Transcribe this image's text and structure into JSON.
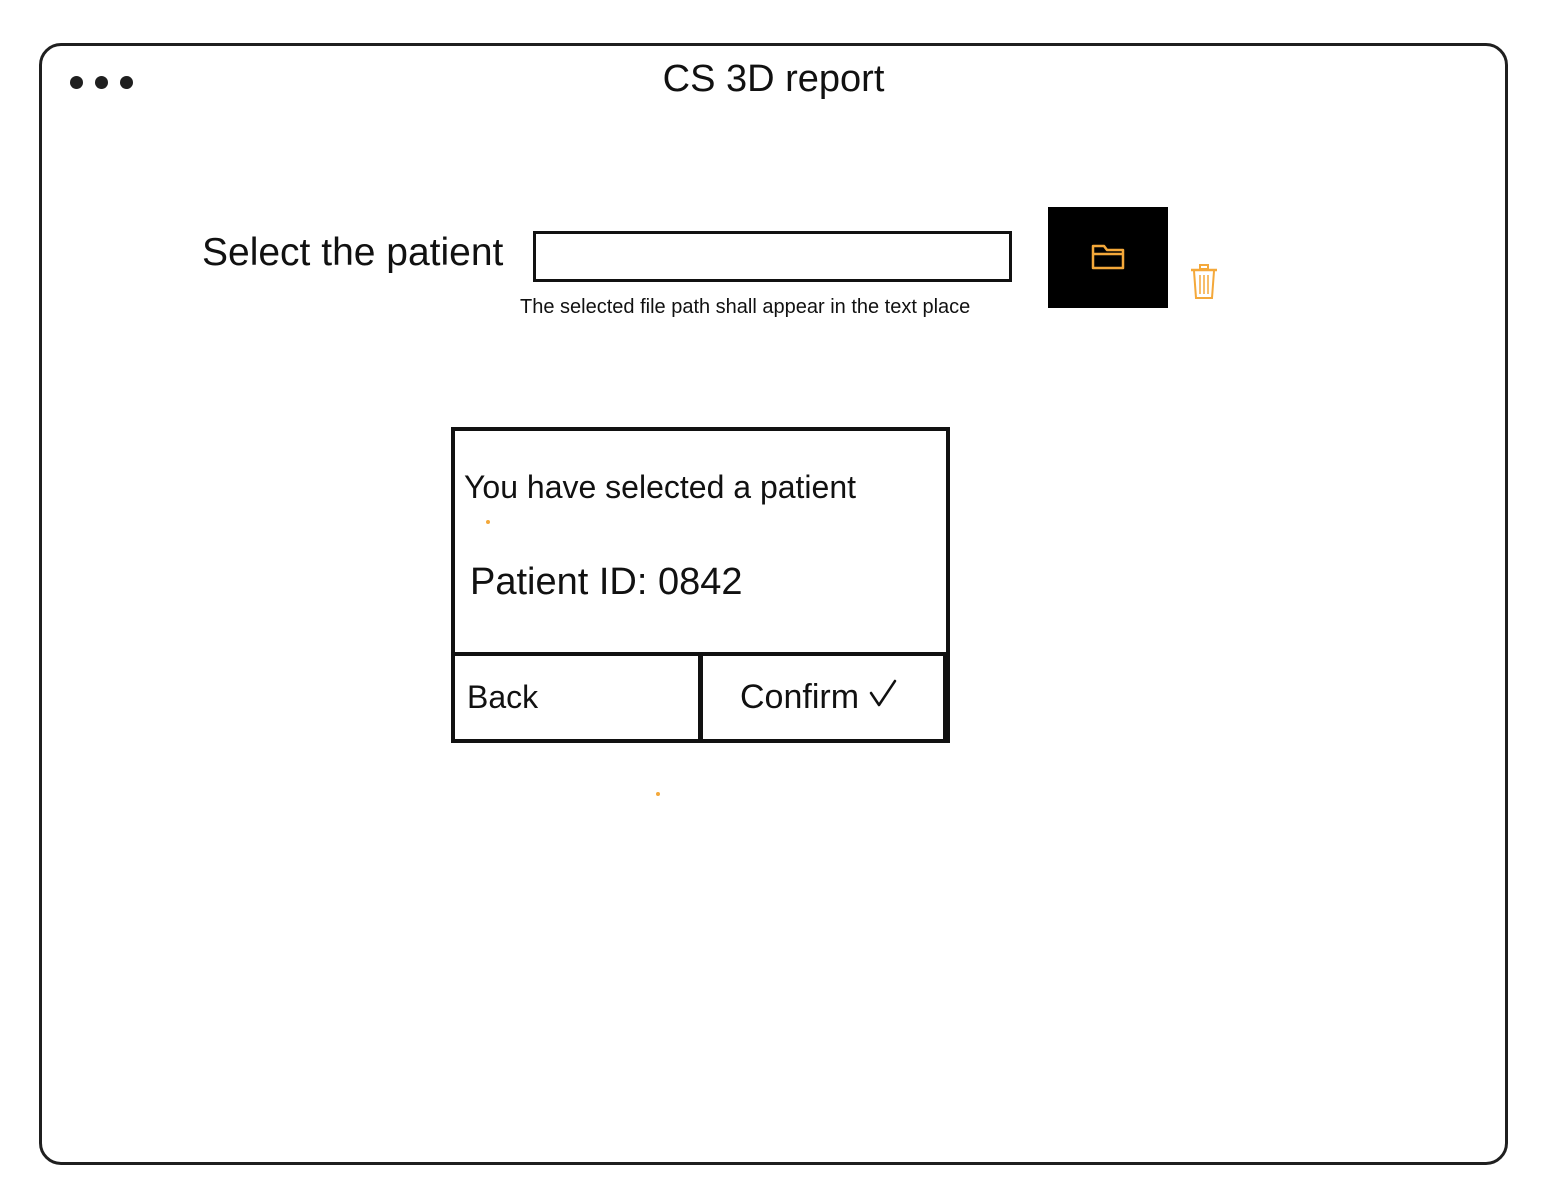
{
  "window": {
    "title": "CS 3D report"
  },
  "patient_select": {
    "label": "Select the patient",
    "path_value": "",
    "hint": "The selected file path shall appear in the text place",
    "browse_icon": "folder-icon",
    "delete_icon": "trash-icon"
  },
  "dialog": {
    "message": "You have selected a patient",
    "patient_id": "Patient ID: 0842",
    "back_label": "Back",
    "confirm_label": "Confirm",
    "confirm_icon": "checkmark-icon"
  },
  "colors": {
    "accent": "#f4a83a",
    "border": "#1f1f1f",
    "button_dark": "#000000"
  }
}
